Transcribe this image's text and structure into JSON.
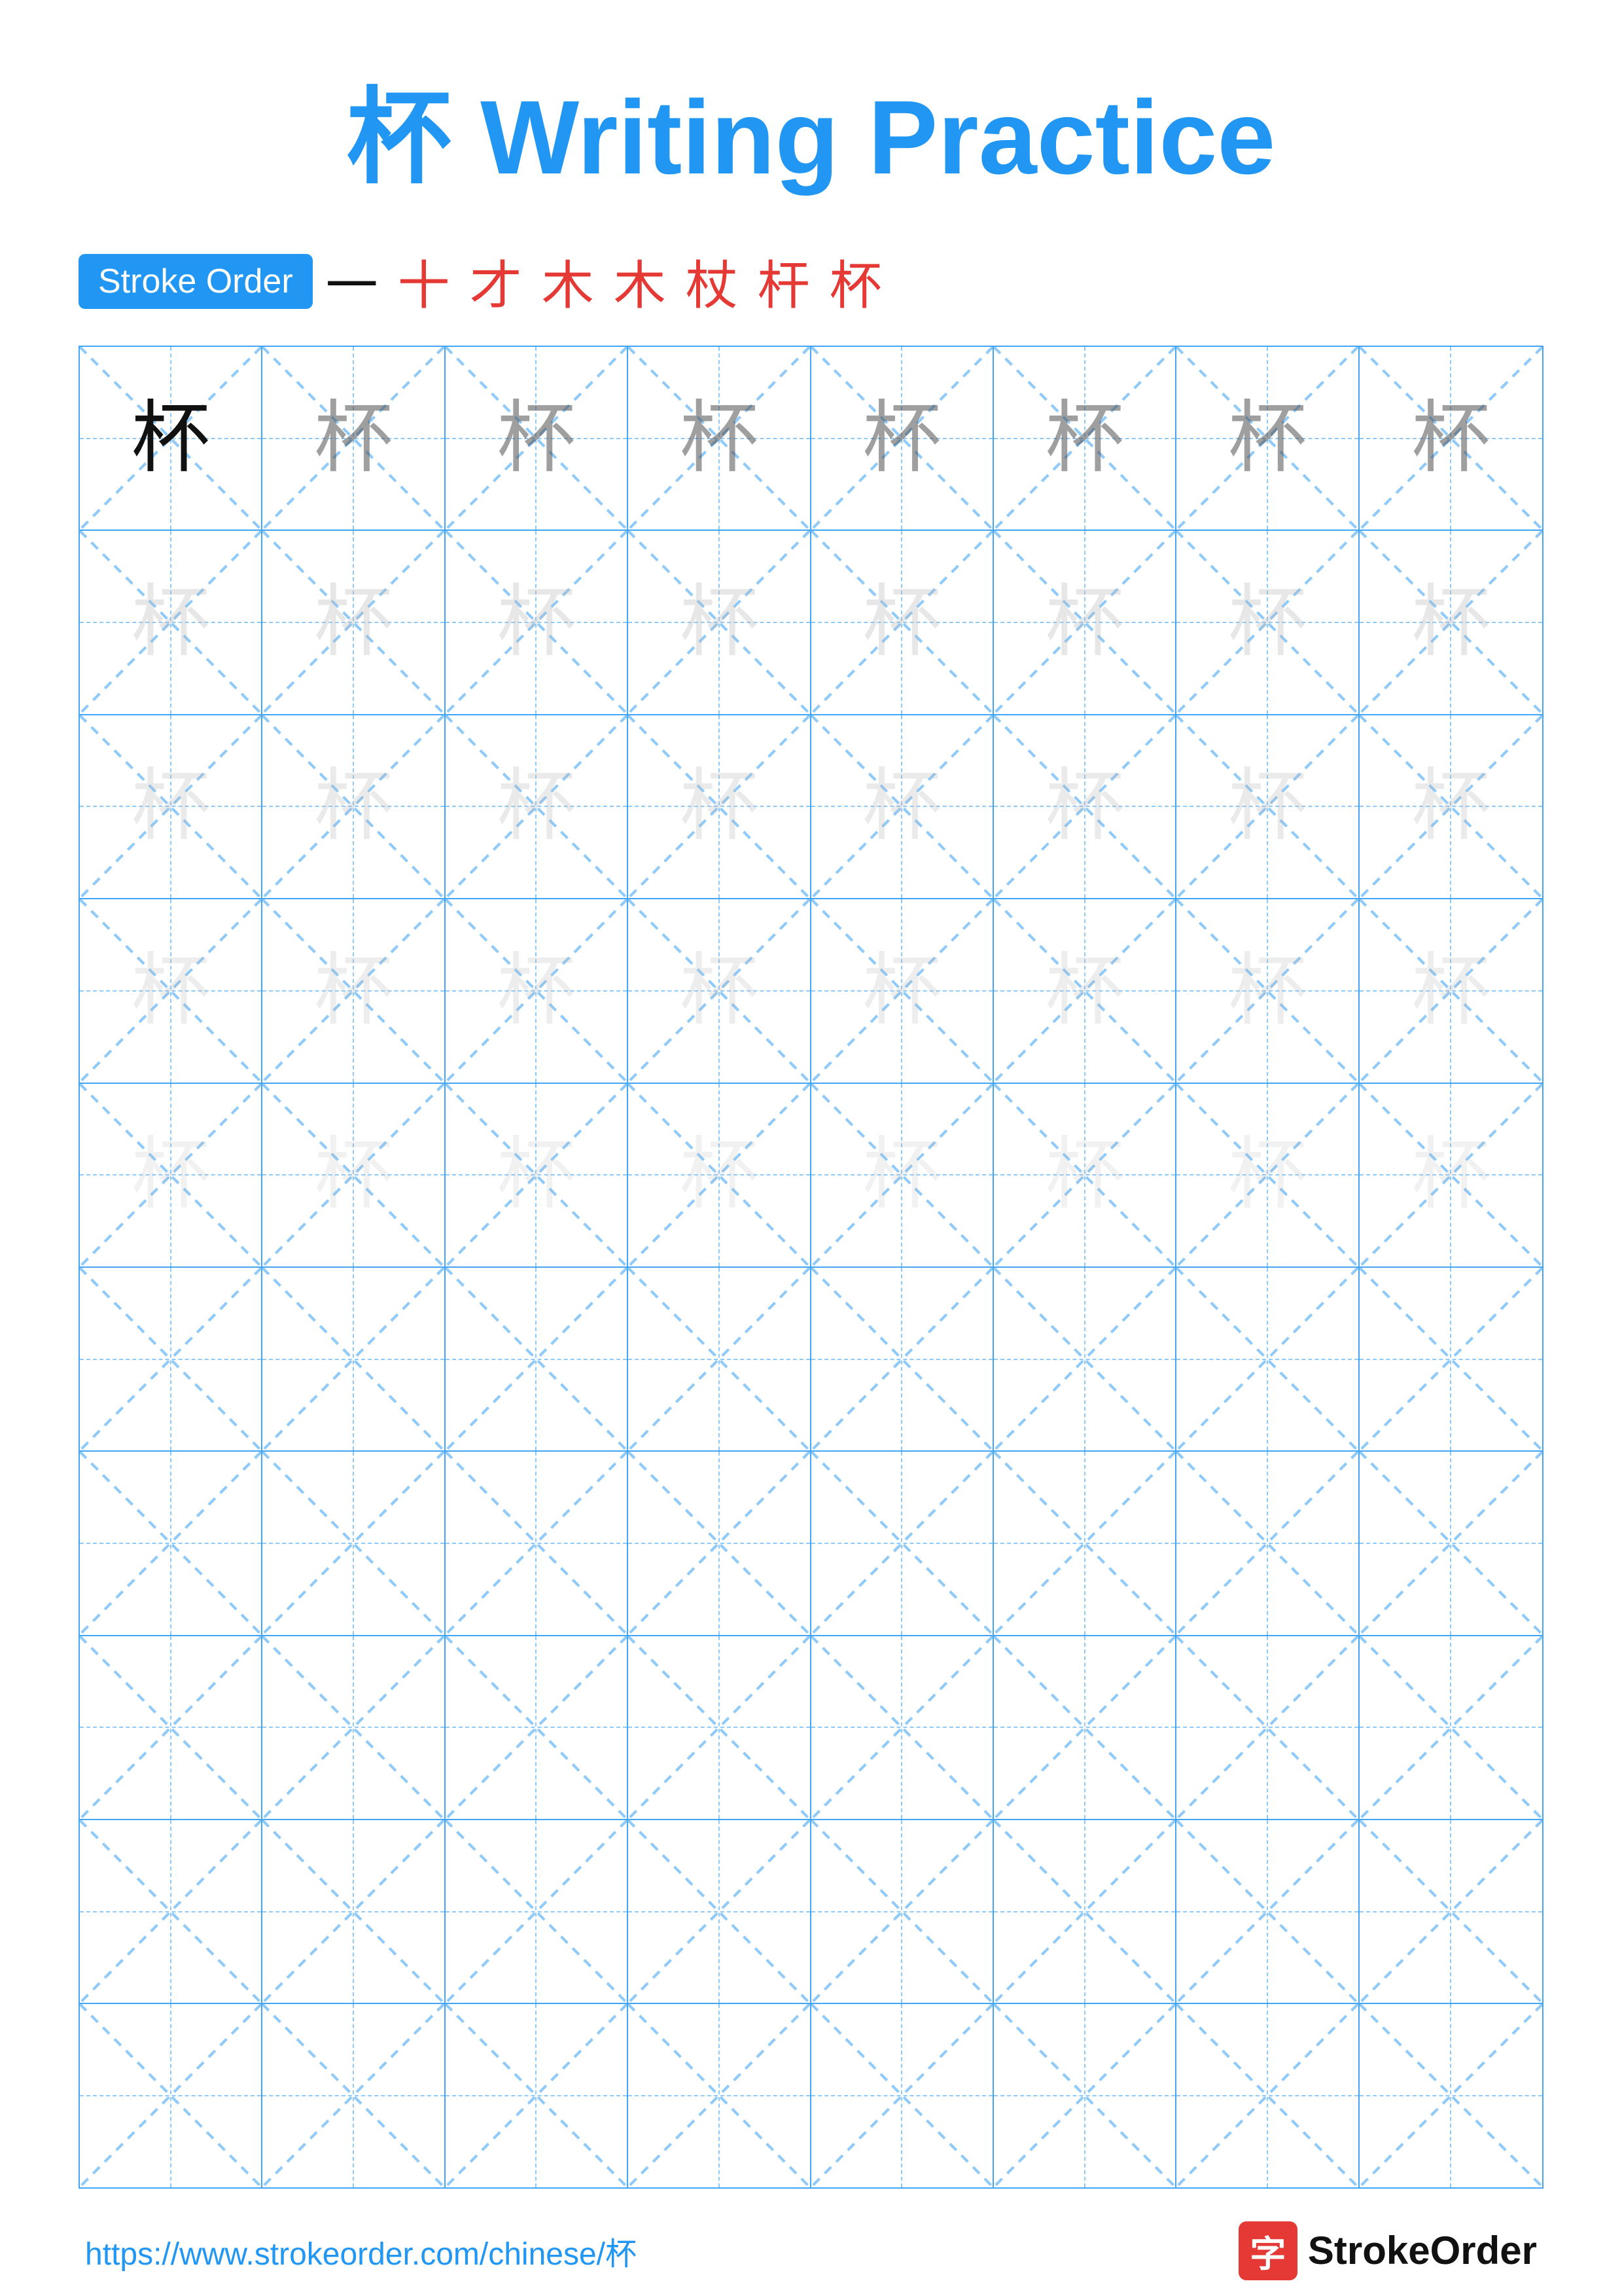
{
  "title": {
    "chinese_char": "杯",
    "label": "Writing Practice",
    "color": "#2196F3"
  },
  "stroke_order": {
    "badge_label": "Stroke Order",
    "strokes": [
      "一",
      "十",
      "才",
      "木",
      "木",
      "杖",
      "杆",
      "杯"
    ]
  },
  "grid": {
    "rows": 10,
    "cols": 8,
    "guide_char": "杯",
    "guide_rows": 5,
    "first_cell_bold": true
  },
  "footer": {
    "url": "https://www.strokeorder.com/chinese/杯",
    "logo_char": "字",
    "logo_name": "StrokeOrder"
  }
}
